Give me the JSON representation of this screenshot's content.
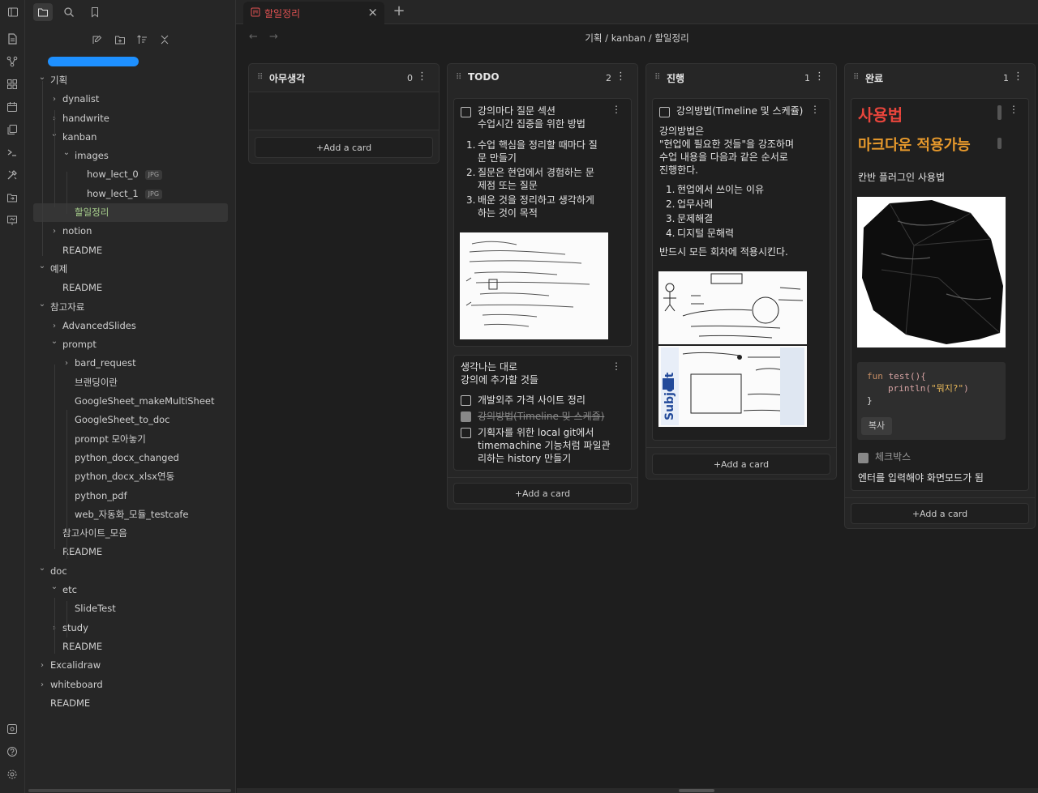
{
  "ribbon": {
    "icons": [
      "files-icon",
      "graph-icon",
      "canvas-icon",
      "calendar-icon",
      "templates-icon",
      "terminal-icon",
      "tools-icon",
      "folder-move-icon",
      "slides-icon",
      "vault-icon",
      "help-icon",
      "settings-icon"
    ]
  },
  "sidebar": {
    "top_icons": [
      "sidebar-toggle-icon",
      "folder-icon",
      "search-icon",
      "bookmark-icon"
    ],
    "actions": [
      "new-note-icon",
      "new-folder-icon",
      "sort-icon",
      "collapse-icon"
    ],
    "tree": [
      {
        "label": "기획",
        "level": 0,
        "expanded": true,
        "folder": true
      },
      {
        "label": "dynalist",
        "level": 1,
        "expanded": false,
        "folder": true
      },
      {
        "label": "handwrite",
        "level": 1,
        "expanded": false,
        "folder": true
      },
      {
        "label": "kanban",
        "level": 1,
        "expanded": true,
        "folder": true
      },
      {
        "label": "images",
        "level": 2,
        "expanded": true,
        "folder": true
      },
      {
        "label": "how_lect_0",
        "level": 3,
        "folder": false,
        "badge": "JPG"
      },
      {
        "label": "how_lect_1",
        "level": 3,
        "folder": false,
        "badge": "JPG"
      },
      {
        "label": "할일정리",
        "level": 2,
        "folder": false,
        "selected": true
      },
      {
        "label": "notion",
        "level": 1,
        "expanded": false,
        "folder": true
      },
      {
        "label": "README",
        "level": 1,
        "folder": false
      },
      {
        "label": "예제",
        "level": 0,
        "expanded": true,
        "folder": true
      },
      {
        "label": "README",
        "level": 1,
        "folder": false
      },
      {
        "label": "참고자료",
        "level": 0,
        "expanded": true,
        "folder": true
      },
      {
        "label": "AdvancedSlides",
        "level": 1,
        "expanded": false,
        "folder": true
      },
      {
        "label": "prompt",
        "level": 1,
        "expanded": true,
        "folder": true
      },
      {
        "label": "bard_request",
        "level": 2,
        "expanded": false,
        "folder": true
      },
      {
        "label": "브랜딩이란",
        "level": 2,
        "folder": false
      },
      {
        "label": "GoogleSheet_makeMultiSheet",
        "level": 2,
        "folder": false
      },
      {
        "label": "GoogleSheet_to_doc",
        "level": 2,
        "folder": false
      },
      {
        "label": "prompt 모아놓기",
        "level": 2,
        "folder": false
      },
      {
        "label": "python_docx_changed",
        "level": 2,
        "folder": false
      },
      {
        "label": "python_docx_xlsx연동",
        "level": 2,
        "folder": false
      },
      {
        "label": "python_pdf",
        "level": 2,
        "folder": false
      },
      {
        "label": "web_자동화_모듈_testcafe",
        "level": 2,
        "folder": false
      },
      {
        "label": "참고사이트_모음",
        "level": 1,
        "folder": false
      },
      {
        "label": "README",
        "level": 1,
        "folder": false
      },
      {
        "label": "doc",
        "level": 0,
        "expanded": true,
        "folder": true
      },
      {
        "label": "etc",
        "level": 1,
        "expanded": true,
        "folder": true
      },
      {
        "label": "SlideTest",
        "level": 2,
        "folder": false
      },
      {
        "label": "study",
        "level": 1,
        "expanded": false,
        "folder": true
      },
      {
        "label": "README",
        "level": 1,
        "folder": false
      },
      {
        "label": "Excalidraw",
        "level": 0,
        "expanded": false,
        "folder": true
      },
      {
        "label": "whiteboard",
        "level": 0,
        "expanded": false,
        "folder": true
      },
      {
        "label": "README",
        "level": 0,
        "folder": false
      }
    ]
  },
  "tab": {
    "title": "할일정리",
    "close": "×",
    "new": "+"
  },
  "header": {
    "back": "←",
    "forward": "→",
    "breadcrumb": [
      "기획",
      "/",
      "kanban",
      "/",
      "할일정리"
    ]
  },
  "board": {
    "add_card_label": "+Add a card",
    "lanes": [
      {
        "title": "아무생각",
        "count": "0"
      },
      {
        "title": "TODO",
        "count": "2"
      },
      {
        "title": "진행",
        "count": "1"
      },
      {
        "title": "완료",
        "count": "1"
      }
    ],
    "todo_card1": {
      "title_line1": "강의마다 질문 섹션",
      "title_line2": "수업시간 집중을 위한 방법",
      "items": [
        {
          "n": "1.",
          "text_l1": "수업 핵심을 정리할 때마다 질",
          "text_l2": "문 만들기"
        },
        {
          "n": "2.",
          "text_l1": "질문은 현업에서 경험하는 문",
          "text_l2": "제점 또는 질문"
        },
        {
          "n": "3.",
          "text_l1": "배운 것을 정리하고 생각하게",
          "text_l2": "하는 것이 목적"
        }
      ]
    },
    "todo_card2": {
      "line1": "생각나는 대로",
      "line2": "강의에 추가할 것들",
      "checks": [
        {
          "text_l1": "개발외주 가격 사이트 정리",
          "text_l2": "",
          "checked": false
        },
        {
          "text_l1": "강의방법(Timeline 및 스케쥴)",
          "text_l2": "",
          "checked": true
        },
        {
          "text_l1": "기획자를 위한 local git에서",
          "text_l2": "timemachine 기능처럼 파일관",
          "text_l3": "리하는 history 만들기",
          "checked": false
        }
      ]
    },
    "progress_card": {
      "title": "강의방법(Timeline 및 스케쥴)",
      "p1": "강의방법은",
      "p2": "\"현업에 필요한 것들\"을 강조하며",
      "p3": "수업 내용을 다음과 같은 순서로",
      "p4": "진행한다.",
      "items": [
        {
          "n": "1.",
          "text": "현업에서 쓰이는 이유"
        },
        {
          "n": "2.",
          "text": "업무사례"
        },
        {
          "n": "3.",
          "text": "문제해결"
        },
        {
          "n": "4.",
          "text": "디지털 문해력"
        }
      ],
      "closing": "반드시 모든 회차에 적용시킨다."
    },
    "done_card": {
      "h1": "사용법",
      "h2": "마크다운 적용가능",
      "sub": "칸반 플러그인 사용법",
      "code_l1_kw": "fun",
      "code_l1_fn": " test(){",
      "code_l2_fn": "println(",
      "code_l2_str": "\"뭐지?\"",
      "code_l2_end": ")",
      "code_l3": "}",
      "copy": "복사",
      "checkbox_label": "체크박스",
      "footer": "엔터를 입력해야 화면모드가 됨"
    },
    "colors": {
      "accent_red": "#e05252",
      "h_red": "#e8453c",
      "h_orange": "#e89a2c",
      "selected_green": "#a8d08d"
    }
  }
}
